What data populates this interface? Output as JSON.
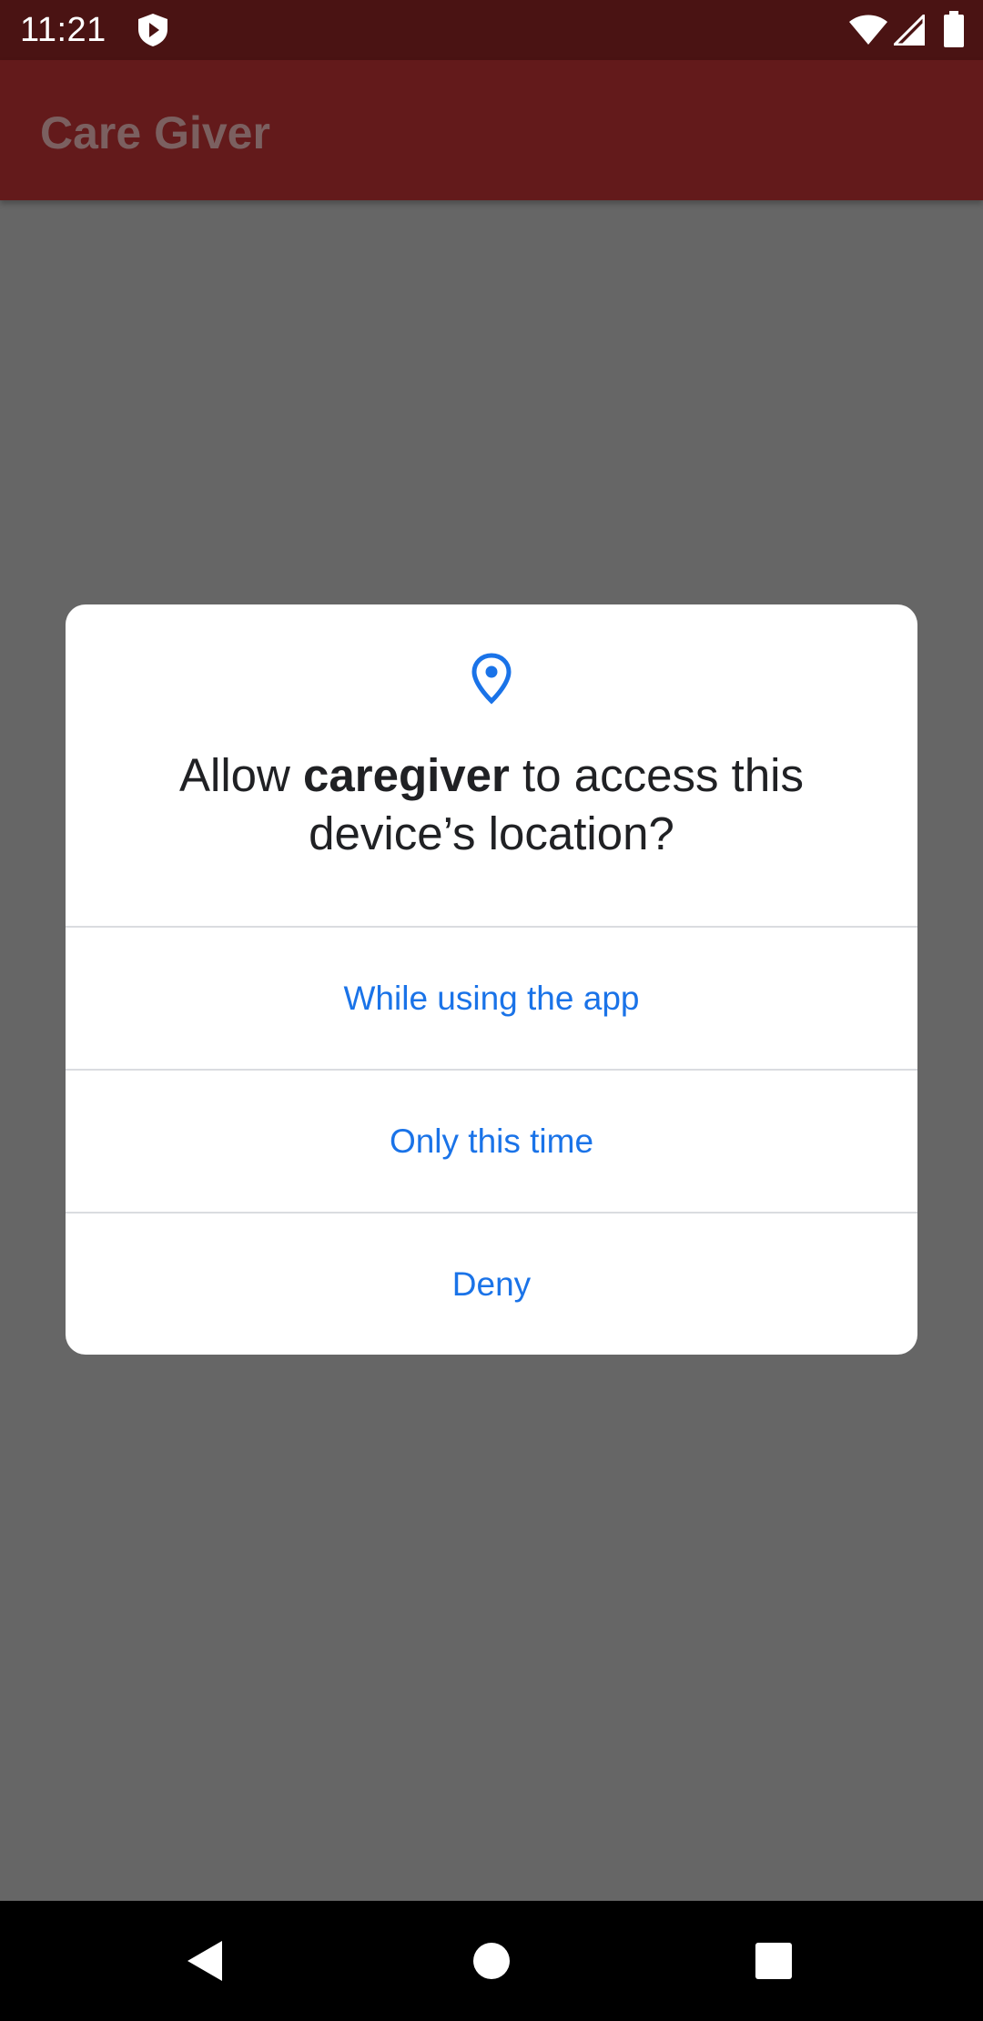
{
  "status_bar": {
    "time": "11:21",
    "icons": [
      "shield-play-icon",
      "wifi-icon",
      "signal-icon",
      "battery-icon"
    ]
  },
  "app_bar": {
    "title": "Care Giver"
  },
  "dialog": {
    "icon": "location-pin-icon",
    "title_prefix": "Allow ",
    "app_name": "caregiver",
    "title_suffix": " to access this device’s location?",
    "options": [
      {
        "label": "While using the app"
      },
      {
        "label": "Only this time"
      },
      {
        "label": "Deny"
      }
    ]
  },
  "nav_bar": {
    "icons": [
      "back-icon",
      "home-icon",
      "recents-icon"
    ]
  },
  "colors": {
    "status_bar": "#4a1313",
    "app_bar": "#631a1b",
    "scrim_background": "#666666",
    "accent": "#1a73e8",
    "dialog_background": "#ffffff"
  }
}
